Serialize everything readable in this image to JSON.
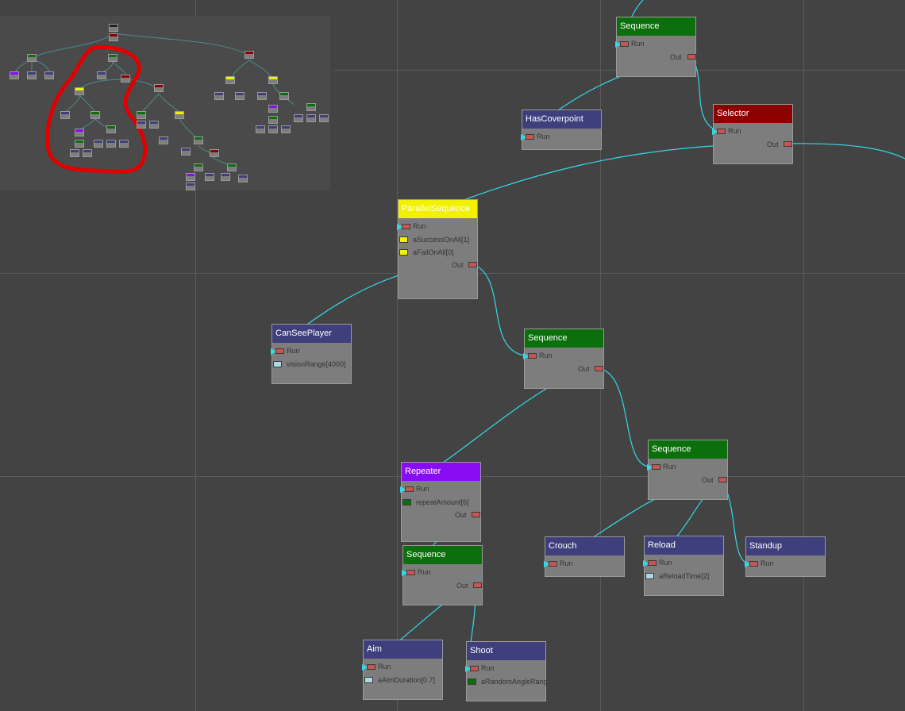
{
  "colors": {
    "background": "#434343",
    "wire": "#33d9e6",
    "sequence": "#0b700b",
    "selector": "#8c0000",
    "action": "#3f3f7e",
    "parallel": "#f2f200",
    "repeater": "#8a0cf5",
    "minimap_highlight": "#e00000"
  },
  "nodes": {
    "seq_top": {
      "title": "Sequence",
      "run": "Run",
      "out": "Out"
    },
    "has_coverpoint": {
      "title": "HasCoverpoint",
      "run": "Run"
    },
    "selector": {
      "title": "Selector",
      "run": "Run",
      "out": "Out"
    },
    "parallel": {
      "title": "ParallelSequence",
      "run": "Run",
      "param1": "aSuccessOnAll[1]",
      "param2": "aFailOnAll[0]",
      "out": "Out"
    },
    "can_see_player": {
      "title": "CanSeePlayer",
      "run": "Run",
      "param1": "visionRange[4000]"
    },
    "seq_mid": {
      "title": "Sequence",
      "run": "Run",
      "out": "Out"
    },
    "seq_right": {
      "title": "Sequence",
      "run": "Run",
      "out": "Out"
    },
    "repeater": {
      "title": "Repeater",
      "run": "Run",
      "param1": "repeatAmount[6]",
      "out": "Out"
    },
    "seq_low": {
      "title": "Sequence",
      "run": "Run",
      "out": "Out"
    },
    "crouch": {
      "title": "Crouch",
      "run": "Run"
    },
    "reload": {
      "title": "Reload",
      "run": "Run",
      "param1": "aReloadTime[2]"
    },
    "standup": {
      "title": "Standup",
      "run": "Run"
    },
    "aim": {
      "title": "Aim",
      "run": "Run",
      "param1": "aAimDuration[0.7]"
    },
    "shoot": {
      "title": "Shoot",
      "run": "Run",
      "param1": "aRandomAngleRang"
    }
  }
}
